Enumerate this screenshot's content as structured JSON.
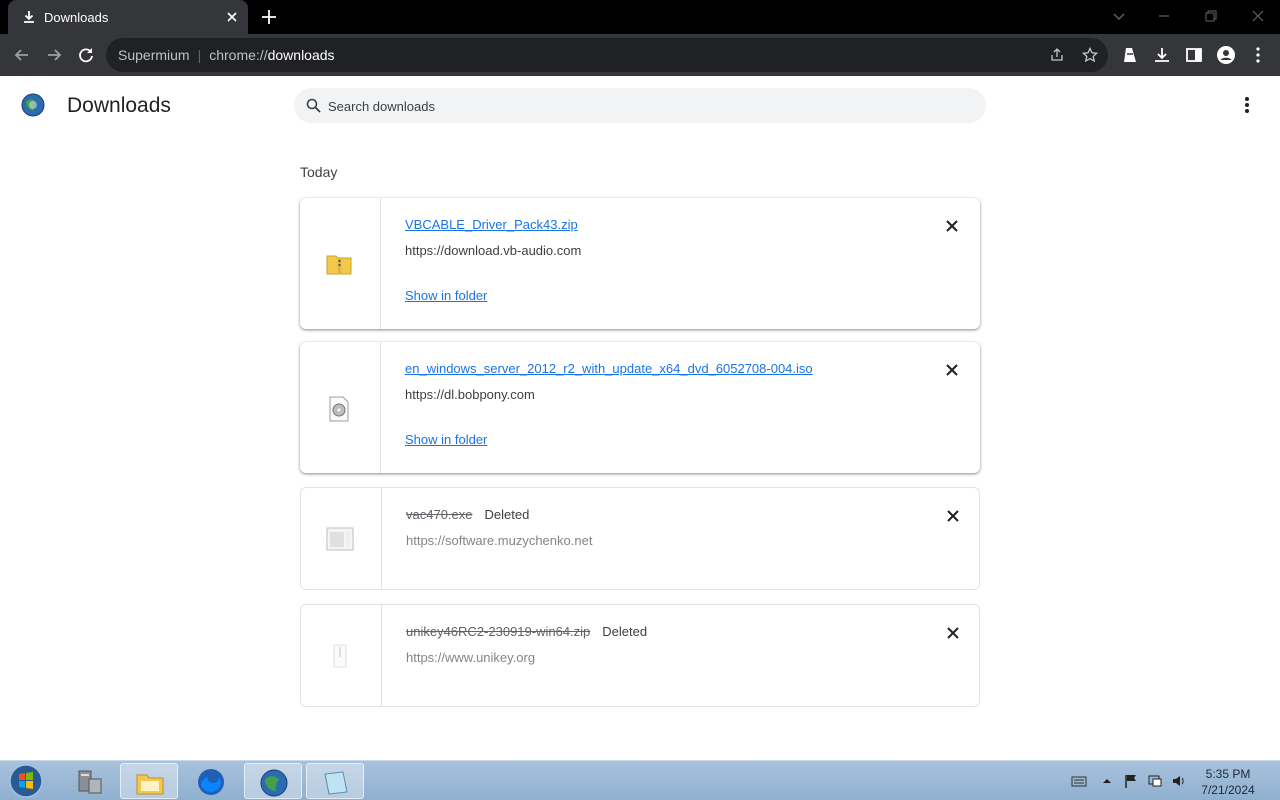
{
  "tab": {
    "title": "Downloads"
  },
  "omnibox": {
    "label": "Supermium",
    "scheme": "chrome://",
    "host": "downloads"
  },
  "page": {
    "title": "Downloads",
    "search_placeholder": "Search downloads"
  },
  "date_label": "Today",
  "downloads": [
    {
      "filename": "VBCABLE_Driver_Pack43.zip",
      "url": "https://download.vb-audio.com",
      "action": "Show in folder",
      "status": "",
      "deleted": false,
      "icon": "zip-folder-icon"
    },
    {
      "filename": "en_windows_server_2012_r2_with_update_x64_dvd_6052708-004.iso",
      "url": "https://dl.bobpony.com",
      "action": "Show in folder",
      "status": "",
      "deleted": false,
      "icon": "disc-image-icon"
    },
    {
      "filename": "vac470.exe",
      "url": "https://software.muzychenko.net",
      "action": "",
      "status": "Deleted",
      "deleted": true,
      "icon": "exe-icon"
    },
    {
      "filename": "unikey46RC2-230919-win64.zip",
      "url": "https://www.unikey.org",
      "action": "",
      "status": "Deleted",
      "deleted": true,
      "icon": "zip-icon"
    }
  ],
  "clock": {
    "time": "5:35 PM",
    "date": "7/21/2024"
  },
  "colors": {
    "accent": "#1a73e8",
    "toolbar": "#35363a",
    "tabstrip": "#000000"
  }
}
